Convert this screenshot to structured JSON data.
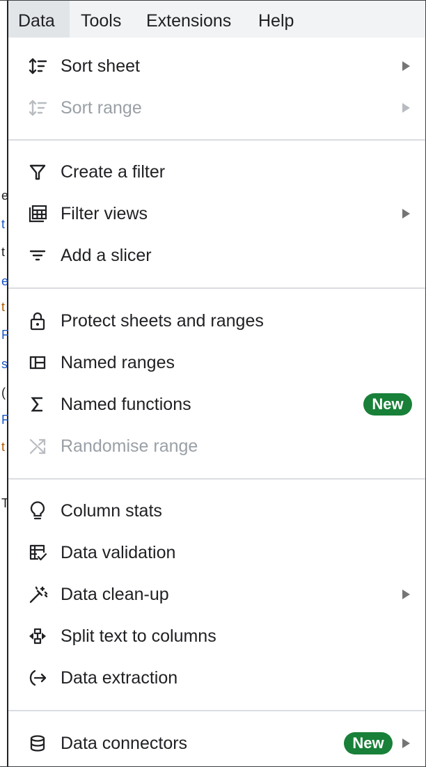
{
  "menubar": {
    "items": [
      {
        "label": "Data",
        "active": true
      },
      {
        "label": "Tools"
      },
      {
        "label": "Extensions"
      },
      {
        "label": "Help"
      }
    ]
  },
  "menu": {
    "sort_sheet": "Sort sheet",
    "sort_range": "Sort range",
    "create_filter": "Create a filter",
    "filter_views": "Filter views",
    "add_slicer": "Add a slicer",
    "protect_sheets": "Protect sheets and ranges",
    "named_ranges": "Named ranges",
    "named_functions": "Named functions",
    "randomise_range": "Randomise range",
    "column_stats": "Column stats",
    "data_validation": "Data validation",
    "data_cleanup": "Data clean-up",
    "split_text": "Split text to columns",
    "data_extraction": "Data extraction",
    "data_connectors": "Data connectors",
    "new_badge": "New"
  },
  "background_glyphs": [
    "e",
    "t",
    "t",
    "e",
    "t",
    "F",
    "s",
    "(",
    "F",
    "t",
    "T"
  ],
  "colors": {
    "badge": "#188038",
    "menubar_bg": "#f1f3f4",
    "disabled_text": "#9aa0a6",
    "text": "#202124",
    "separator": "#dadce0"
  }
}
